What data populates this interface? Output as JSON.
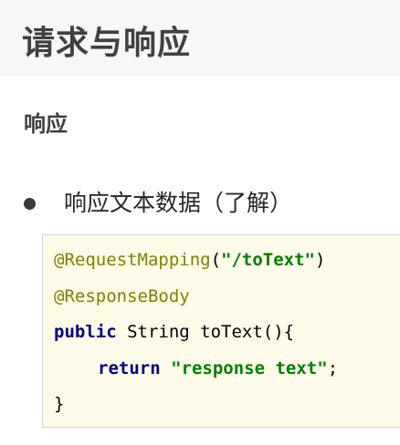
{
  "header": {
    "title": "请求与响应"
  },
  "section": {
    "title": "响应"
  },
  "bullet": {
    "text": "响应文本数据（了解）"
  },
  "code": {
    "line1": {
      "annotation": "@RequestMapping",
      "open": "(",
      "string": "\"/toText\"",
      "close": ")"
    },
    "line2": {
      "annotation": "@ResponseBody"
    },
    "line3": {
      "keyword": "public",
      "rest": " String toText(){"
    },
    "line4": {
      "keyword": "return",
      "space": " ",
      "string": "\"response text\"",
      "end": ";"
    },
    "line5": {
      "text": "}"
    }
  },
  "colors": {
    "annotation": "#808000",
    "string": "#008000",
    "keyword": "#000080",
    "code_background": "#fefbe8",
    "heading": "#404040"
  }
}
